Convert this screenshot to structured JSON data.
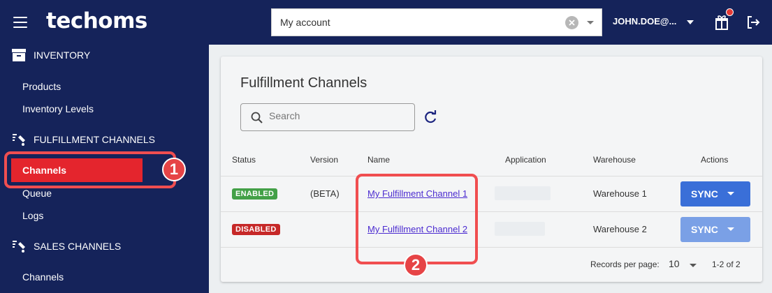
{
  "header": {
    "logo": "techoms",
    "account_value": "My account",
    "user": "JOHN.DOE@..."
  },
  "sidebar": {
    "sections": [
      {
        "label": "INVENTORY",
        "icon": "archive-icon",
        "items": [
          "Products",
          "Inventory Levels"
        ]
      },
      {
        "label": "FULFILLMENT CHANNELS",
        "icon": "fulfillment-icon",
        "items": [
          "Channels",
          "Queue",
          "Logs"
        ]
      },
      {
        "label": "SALES CHANNELS",
        "icon": "sales-icon",
        "items": [
          "Channels"
        ]
      }
    ],
    "active_item": "Channels"
  },
  "main": {
    "title": "Fulfillment Channels",
    "search_placeholder": "Search",
    "columns": [
      "Status",
      "Version",
      "Name",
      "Application",
      "Warehouse",
      "Actions"
    ],
    "rows": [
      {
        "status": "ENABLED",
        "status_color": "#43a047",
        "version": "(BETA)",
        "name": "My Fulfillment Channel 1",
        "application": "",
        "warehouse": "Warehouse 1",
        "action": "SYNC",
        "action_enabled": true
      },
      {
        "status": "DISABLED",
        "status_color": "#c62828",
        "version": "",
        "name": "My Fulfillment Channel 2",
        "application": "",
        "warehouse": "Warehouse 2",
        "action": "SYNC",
        "action_enabled": false
      }
    ],
    "pagination": {
      "records_label": "Records per page:",
      "per_page": "10",
      "range": "1-2 of 2"
    }
  },
  "annotations": [
    "1",
    "2"
  ],
  "colors": {
    "nav_bg": "#15235a",
    "active_item": "#e4252d",
    "primary_button": "#3a6fd8",
    "primary_button_disabled": "#7aa0e6",
    "callout": "#f04e50"
  }
}
